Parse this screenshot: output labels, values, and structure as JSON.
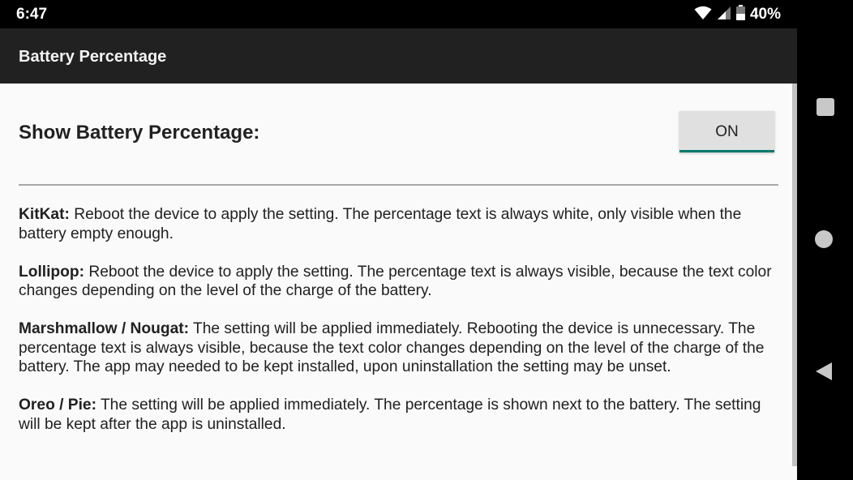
{
  "status_bar": {
    "time": "6:47",
    "battery_percent": "40%",
    "icons": [
      "wifi-icon",
      "cell-signal-icon",
      "battery-icon"
    ]
  },
  "app_bar": {
    "title": "Battery Percentage"
  },
  "setting": {
    "label": "Show Battery Percentage:",
    "toggle_label": "ON",
    "toggle_accent": "#00796b"
  },
  "info": [
    {
      "heading": "KitKat:",
      "text": " Reboot the device to apply the setting. The percentage text is always white, only visible when the battery empty enough."
    },
    {
      "heading": "Lollipop:",
      "text": " Reboot the device to apply the setting. The percentage text is always visible, because the text color changes depending on the level of the charge of the battery."
    },
    {
      "heading": "Marshmallow / Nougat:",
      "text": " The setting will be applied immediately. Rebooting the device is unnecessary. The percentage text is always visible, because the text color changes depending on the level of the charge of the battery. The app may needed to be kept installed, upon uninstallation the setting may be unset."
    },
    {
      "heading": "Oreo / Pie:",
      "text": " The setting will be applied immediately. The percentage is shown next to the battery. The setting will be kept after the app is uninstalled."
    }
  ],
  "nav_bar": {
    "buttons": [
      "recent-apps-icon",
      "home-icon",
      "back-icon"
    ]
  }
}
